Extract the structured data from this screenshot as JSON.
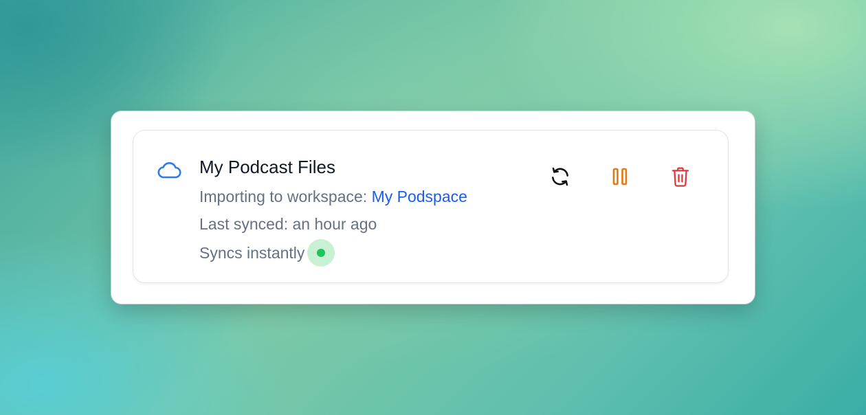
{
  "connection": {
    "title": "My Podcast Files",
    "workspace_prefix": "Importing to workspace:",
    "workspace_name": "My Podspace",
    "last_synced": "Last synced: an hour ago",
    "sync_mode": "Syncs instantly",
    "status": "active"
  },
  "icons": {
    "source": "cloud-icon",
    "sync": "refresh-icon",
    "pause": "pause-icon",
    "delete": "trash-icon"
  },
  "colors": {
    "cloud": "#2f7bea",
    "link": "#1d5ee8",
    "sync": "#111111",
    "pause": "#e07a12",
    "delete": "#e5383b",
    "status_dot": "#1dc45a",
    "status_halo": "#c8f0d3"
  }
}
